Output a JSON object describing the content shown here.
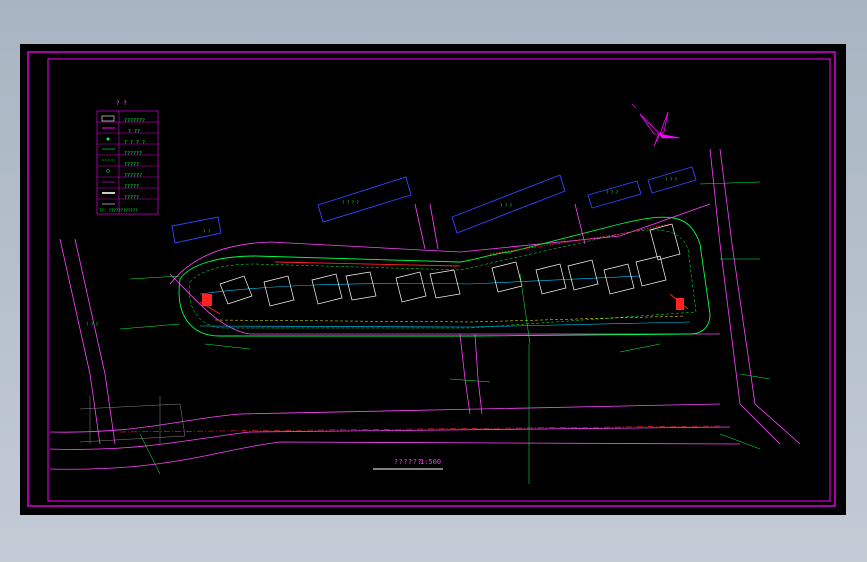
{
  "drawing": {
    "title": "??????",
    "scale": "1:500"
  },
  "legend": {
    "heading": "? ?",
    "rows": [
      {
        "label": "???????"
      },
      {
        "label": "? ??"
      },
      {
        "label": "? ? ? ?"
      },
      {
        "label": "??????"
      },
      {
        "label": "?????"
      },
      {
        "label": "??????"
      },
      {
        "label": "?????"
      },
      {
        "label": "?????"
      }
    ],
    "note": "??: ????????????"
  },
  "buildings": {
    "north_block_labels": [
      "? ?",
      "? ? ? ?",
      "? ? ?",
      "? ? ?",
      "? ? ?",
      "? ? ?"
    ]
  },
  "colors": {
    "frame": "#ff00ff",
    "site_line": "#00ff44",
    "existing_building": "#3344ff",
    "road": "#ff44ff",
    "highlight": "#ff2222",
    "water": "#00ccff",
    "annotation_yellow": "#ffff00"
  },
  "icons": {
    "north_arrow": "north-arrow-icon"
  }
}
